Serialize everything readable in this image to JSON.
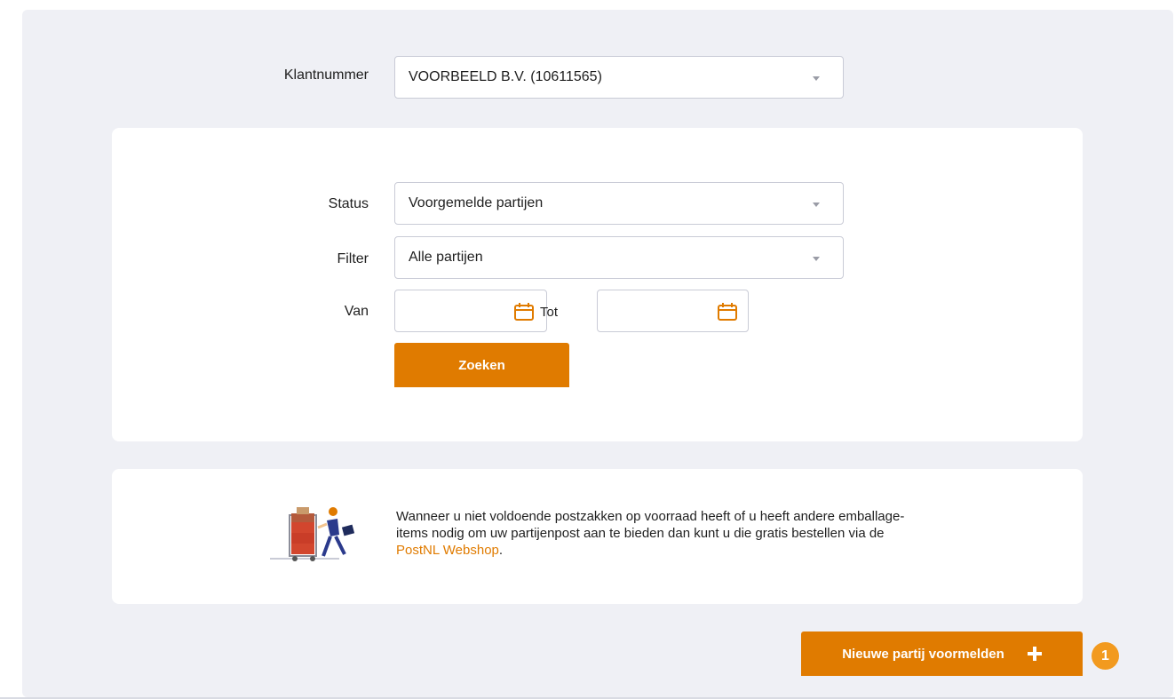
{
  "klantnummer": {
    "label": "Klantnummer",
    "value": "VOORBEELD B.V. (10611565)"
  },
  "search": {
    "status_label": "Status",
    "status_value": "Voorgemelde partijen",
    "filter_label": "Filter",
    "filter_value": "Alle partijen",
    "from_label": "Van",
    "to_label": "Tot",
    "from_value": "",
    "to_value": "",
    "search_button": "Zoeken"
  },
  "info": {
    "line1": "Wanneer u niet voldoende postzakken op voorraad heeft of u heeft andere emballage-",
    "line2": "items nodig om uw partijenpost aan te bieden dan kunt u die gratis bestellen via de",
    "link": "PostNL Webshop",
    "suffix": "."
  },
  "new_button": {
    "label": "Nieuwe partij voormelden",
    "icon": "plus-icon"
  },
  "badge": "1",
  "colors": {
    "accent": "#e07b00",
    "badge": "#f29a1f",
    "background": "#eff0f5"
  }
}
